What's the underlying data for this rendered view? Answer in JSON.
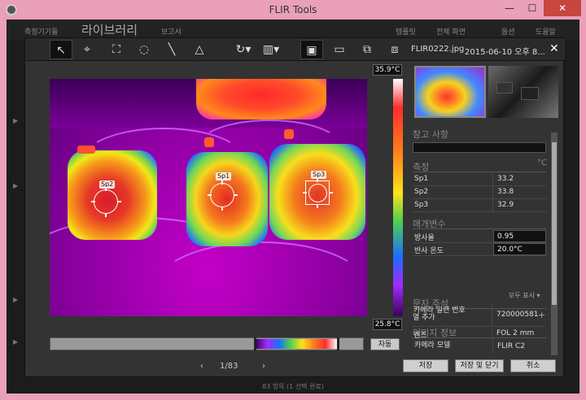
{
  "window": {
    "title": "FLIR Tools",
    "min": "—",
    "max": "☐",
    "close": "✕"
  },
  "background": {
    "nav": [
      "측정기기들",
      "라이브러리",
      "보고서",
      "템플릿",
      "전체 화면",
      "옵션",
      "도움말"
    ],
    "status": "83 항목 (1 선택 완료)"
  },
  "dialog": {
    "file_name": "FLIR0222.jpg",
    "file_date": "2015-06-10 오후 8...",
    "close": "✕",
    "tools": [
      "↖",
      "⌖",
      "⛶",
      "◌",
      "╲",
      "△",
      "↻▾",
      "▥▾",
      "▣",
      "▭",
      "⧉",
      "⧈"
    ],
    "temp_max": "35.9°C",
    "temp_min": "25.8°C",
    "auto_button": "자동",
    "spots": [
      {
        "label": "Sp2"
      },
      {
        "label": "Sp1"
      },
      {
        "label": "Sp3"
      }
    ],
    "pager": {
      "prev": "‹",
      "text": "1/83",
      "next": "›"
    },
    "buttons": {
      "save": "저장",
      "save_close": "저장 및 닫기",
      "cancel": "취소"
    }
  },
  "panel": {
    "notes_title": "참고 사항",
    "measure_title": "측정",
    "measure_unit": "°C",
    "measurements": [
      {
        "name": "Sp1",
        "value": "33.2"
      },
      {
        "name": "Sp2",
        "value": "33.8"
      },
      {
        "name": "Sp3",
        "value": "32.9"
      }
    ],
    "params_title": "매개변수",
    "params": [
      {
        "name": "방사율",
        "value": "0.95"
      },
      {
        "name": "반사 온도",
        "value": "20.0°C"
      }
    ],
    "show_all": "모두 표시 ▾",
    "annotations_title": "문자 주석",
    "add_column": "열 추가",
    "add_plus": "+",
    "image_info_title": "이미지 정보",
    "image_info": [
      {
        "name": "카메라 모델",
        "value": "FLIR C2"
      },
      {
        "name": "카메라 일련 번호",
        "value": "720000581"
      },
      {
        "name": "렌즈",
        "value": "FOL 2 mm"
      }
    ]
  }
}
